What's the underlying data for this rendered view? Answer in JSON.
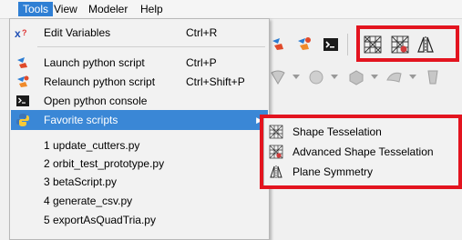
{
  "menubar": {
    "items": [
      {
        "label": "Tools"
      },
      {
        "label": "View"
      },
      {
        "label": "Modeler"
      },
      {
        "label": "Help"
      }
    ]
  },
  "tools_menu": {
    "edit_variables": {
      "label": "Edit Variables",
      "shortcut": "Ctrl+R"
    },
    "launch_python": {
      "label": "Launch python script",
      "shortcut": "Ctrl+P"
    },
    "relaunch_python": {
      "label": "Relaunch python script",
      "shortcut": "Ctrl+Shift+P"
    },
    "open_console": {
      "label": "Open python console"
    },
    "favorite_scripts": {
      "label": "Favorite scripts"
    },
    "recent": [
      "1 update_cutters.py",
      "2 orbit_test_prototype.py",
      "3 betaScript.py",
      "4 generate_csv.py",
      "5 exportAsQuadTria.py"
    ]
  },
  "favorites_submenu": {
    "items": [
      {
        "label": "Shape Tesselation",
        "icon": "tesselation-icon"
      },
      {
        "label": "Advanced Shape Tesselation",
        "icon": "advanced-tesselation-icon"
      },
      {
        "label": "Plane Symmetry",
        "icon": "plane-symmetry-icon"
      }
    ]
  },
  "colors": {
    "highlight": "#3a87d6",
    "annotation": "#e3141f",
    "menu_active": "#2f7fd4"
  }
}
